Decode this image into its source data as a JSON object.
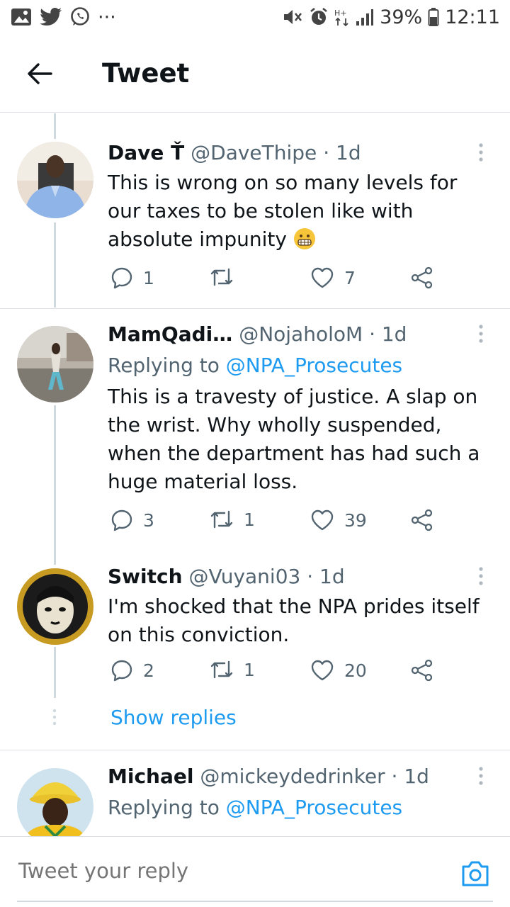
{
  "status_bar": {
    "battery": "39%",
    "time": "12:11",
    "more": "···"
  },
  "header": {
    "title": "Tweet"
  },
  "tweets": [
    {
      "name": "Dave Ť",
      "handle": "@DaveThipe",
      "time": "· 1d",
      "replying_to_label": "",
      "replying_to": "",
      "text": "This is wrong on so many levels for our taxes to be stolen like with absolute impunity",
      "emoji": "grimacing-face",
      "replies": "1",
      "retweets": "",
      "likes": "7"
    },
    {
      "name": "MamQadi…",
      "handle": "@NojaholoM",
      "time": "· 1d",
      "replying_to_label": "Replying to",
      "replying_to": "@NPA_Prosecutes",
      "text": "This is a travesty of justice. A slap on the wrist. Why wholly suspended, when the department has had such a huge material loss.",
      "replies": "3",
      "retweets": "1",
      "likes": "39"
    },
    {
      "name": "Switch",
      "handle": "@Vuyani03",
      "time": "· 1d",
      "replying_to_label": "",
      "replying_to": "",
      "text": "I'm shocked that the NPA prides itself on this conviction.",
      "replies": "2",
      "retweets": "1",
      "likes": "20"
    },
    {
      "name": "Michael",
      "handle": "@mickeydedrinker",
      "time": "· 1d",
      "replying_to_label": "Replying to",
      "replying_to": "@NPA_Prosecutes",
      "text": ""
    }
  ],
  "show_replies": "Show replies",
  "reply_bar": {
    "placeholder": "Tweet your reply"
  },
  "colors": {
    "accent": "#1d9bf0",
    "text": "#0f1419",
    "secondary": "#536471",
    "divider": "#dcdfe3"
  },
  "icons": [
    "gallery-icon",
    "twitter-icon",
    "whatsapp-icon",
    "mute-icon",
    "alarm-icon",
    "data-icon",
    "signal-icon",
    "battery-icon",
    "back-arrow-icon",
    "more-vertical-icon",
    "reply-icon",
    "retweet-icon",
    "like-icon",
    "share-icon",
    "camera-icon"
  ]
}
